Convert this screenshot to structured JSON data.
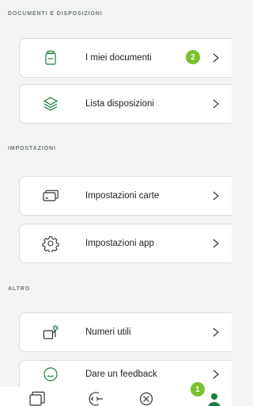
{
  "sections": [
    {
      "title": "DOCUMENTI E DISPOSIZIONI"
    },
    {
      "title": "IMPOSTAZIONI"
    },
    {
      "title": "ALTRO"
    }
  ],
  "rows": [
    {
      "label": "I miei documenti",
      "icon": "document-icon",
      "badge": "2"
    },
    {
      "label": "Lista disposizioni",
      "icon": "layers-icon"
    },
    {
      "label": "Impostazioni carte",
      "icon": "cards-icon"
    },
    {
      "label": "Impostazioni app",
      "icon": "gear-icon"
    },
    {
      "label": "Numeri utili",
      "icon": "phone-icon"
    },
    {
      "label": "Dare un feedback",
      "icon": "feedback-icon"
    }
  ],
  "tabbar": {
    "items": [
      {
        "icon": "cards-tab-icon"
      },
      {
        "icon": "transfer-tab-icon"
      },
      {
        "icon": "circle-x-tab-icon"
      },
      {
        "icon": "profile-tab-icon",
        "badge": "1"
      }
    ]
  },
  "colors": {
    "accent": "#1a7f3c",
    "badge": "#7ac12c",
    "background": "#f4f4f4"
  }
}
